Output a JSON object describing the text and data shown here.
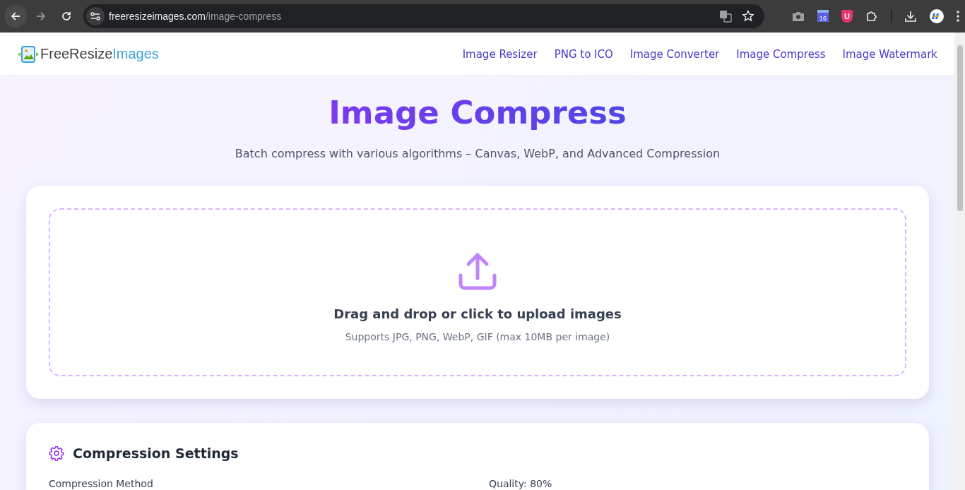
{
  "browser": {
    "url_host": "freeresizeimages.com",
    "url_path": "/image-compress",
    "calendar_day": "16",
    "shield_letter": "U"
  },
  "site": {
    "logo_first": "FreeResize",
    "logo_second": "Images",
    "nav": [
      {
        "label": "Image Resizer",
        "selected": false
      },
      {
        "label": "PNG to ICO",
        "selected": false
      },
      {
        "label": "Image Converter",
        "selected": false
      },
      {
        "label": "Image Compress",
        "selected": false
      },
      {
        "label": "Image Watermark",
        "selected": false
      }
    ]
  },
  "hero": {
    "title": "Image Compress",
    "subtitle": "Batch compress with various algorithms – Canvas, WebP, and Advanced Compression"
  },
  "upload": {
    "prompt": "Drag and drop or click to upload images",
    "hint": "Supports JPG, PNG, WebP, GIF (max 10MB per image)"
  },
  "settings": {
    "title": "Compression Settings",
    "method_label": "Compression Method",
    "quality_label": "Quality: 80%"
  }
}
